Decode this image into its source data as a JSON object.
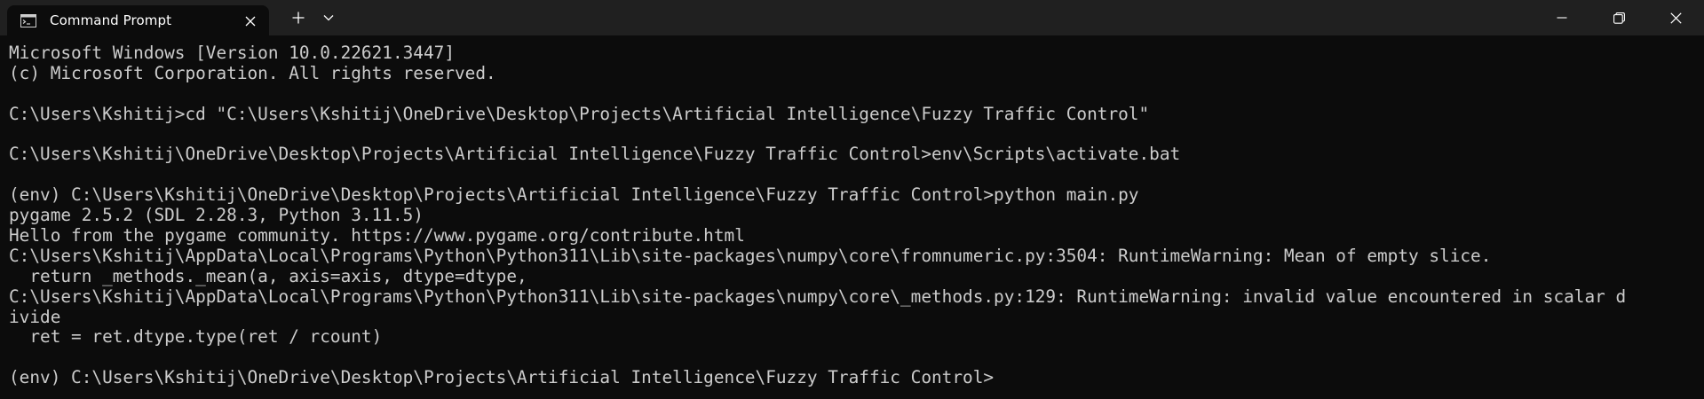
{
  "window": {
    "tab_title": "Command Prompt",
    "icons": {
      "tab_icon": "console-icon",
      "close_tab": "close-icon",
      "new_tab": "plus-icon",
      "dropdown": "chevron-down-icon",
      "minimize": "minimize-icon",
      "maximize": "restore-icon",
      "close_window": "close-icon"
    }
  },
  "colors": {
    "titlebar_bg": "#202020",
    "tab_bg": "#0c0c0c",
    "console_bg": "#0c0c0c",
    "console_text": "#cccccc"
  },
  "console": {
    "lines": [
      "Microsoft Windows [Version 10.0.22621.3447]",
      "(c) Microsoft Corporation. All rights reserved.",
      "",
      "C:\\Users\\Kshitij>cd \"C:\\Users\\Kshitij\\OneDrive\\Desktop\\Projects\\Artificial Intelligence\\Fuzzy Traffic Control\"",
      "",
      "C:\\Users\\Kshitij\\OneDrive\\Desktop\\Projects\\Artificial Intelligence\\Fuzzy Traffic Control>env\\Scripts\\activate.bat",
      "",
      "(env) C:\\Users\\Kshitij\\OneDrive\\Desktop\\Projects\\Artificial Intelligence\\Fuzzy Traffic Control>python main.py",
      "pygame 2.5.2 (SDL 2.28.3, Python 3.11.5)",
      "Hello from the pygame community. https://www.pygame.org/contribute.html",
      "C:\\Users\\Kshitij\\AppData\\Local\\Programs\\Python\\Python311\\Lib\\site-packages\\numpy\\core\\fromnumeric.py:3504: RuntimeWarning: Mean of empty slice.",
      "  return _methods._mean(a, axis=axis, dtype=dtype,",
      "C:\\Users\\Kshitij\\AppData\\Local\\Programs\\Python\\Python311\\Lib\\site-packages\\numpy\\core\\_methods.py:129: RuntimeWarning: invalid value encountered in scalar d",
      "ivide",
      "  ret = ret.dtype.type(ret / rcount)",
      "",
      "(env) C:\\Users\\Kshitij\\OneDrive\\Desktop\\Projects\\Artificial Intelligence\\Fuzzy Traffic Control>"
    ]
  }
}
